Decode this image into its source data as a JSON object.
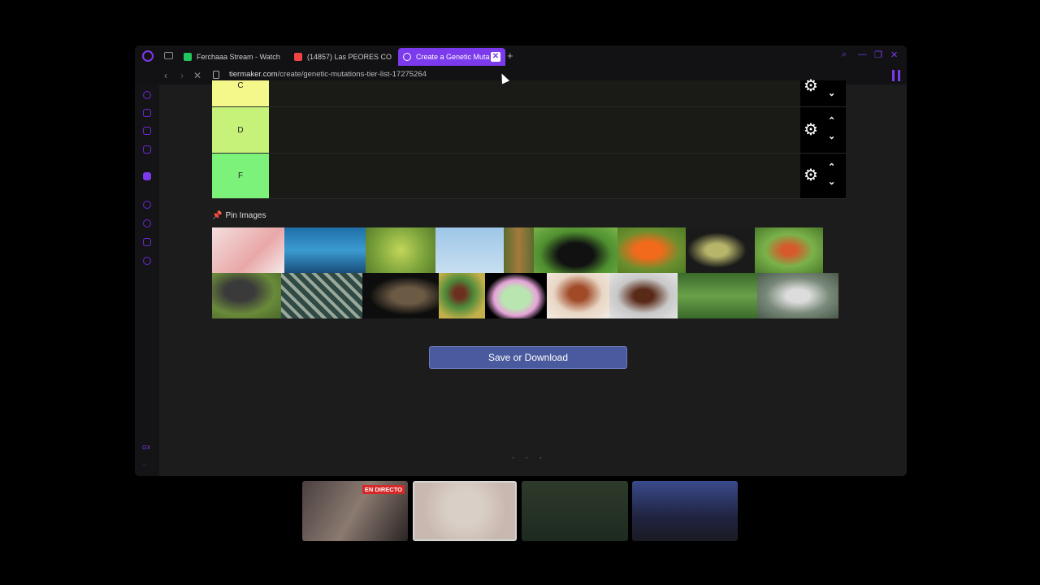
{
  "browser": {
    "tabs": [
      {
        "label": "Ferchaaa Stream - Watch",
        "favicon_color": "#22c55e"
      },
      {
        "label": "(14857) Las PEORES CON",
        "favicon_color": "#ef4444"
      },
      {
        "label": "Create a Genetic Muta",
        "favicon_color": "#ffffff",
        "active": true
      }
    ],
    "new_tab": "+",
    "url_host": "tiermaker.com",
    "url_path": "/create/genetic-mutations-tier-list-17275264",
    "accent": "#7c3aed"
  },
  "sidebar": {
    "icons": [
      "refresh-icon",
      "bag-icon",
      "messenger-icon",
      "music-icon",
      "twitch-icon",
      "plus-icon",
      "history-icon",
      "extensions-icon",
      "settings-icon"
    ],
    "gx_label": "GX",
    "more_label": "..."
  },
  "tiers": [
    {
      "label": "C",
      "color": "#f4f78a"
    },
    {
      "label": "D",
      "color": "#c7f27a"
    },
    {
      "label": "F",
      "color": "#7cf27b"
    }
  ],
  "pin_images": {
    "label": "Pin Images",
    "images": [
      "axolotl",
      "shark",
      "frog",
      "bird",
      "bat",
      "beetle",
      "goldfish",
      "mantis",
      "chameleon",
      "tarantula",
      "octopus",
      "cat",
      "fly",
      "tardigrade",
      "flea",
      "cockroach",
      "dragonfly",
      "hummingbird"
    ]
  },
  "save_button": "Save or Download",
  "overlay": {
    "live_badge": "EN DIRECTO"
  }
}
